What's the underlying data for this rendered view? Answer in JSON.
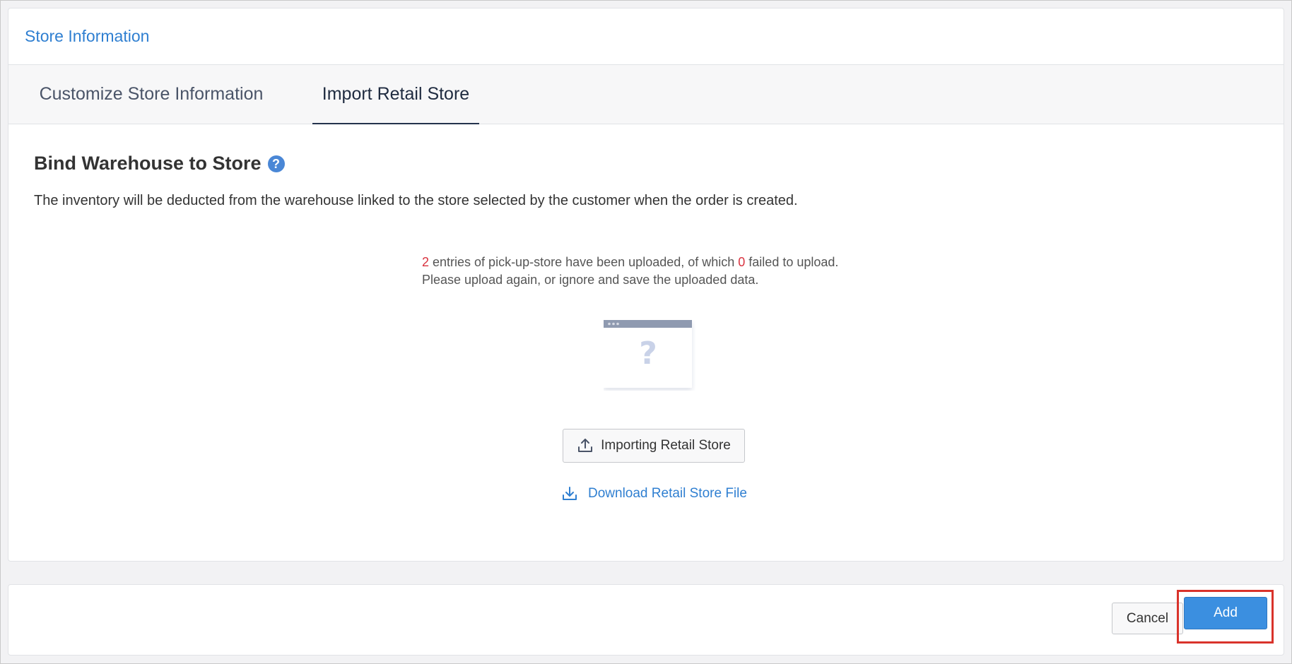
{
  "panel": {
    "title": "Store Information"
  },
  "tabs": [
    {
      "label": "Customize Store Information",
      "active": false
    },
    {
      "label": "Import Retail Store",
      "active": true
    }
  ],
  "section": {
    "title": "Bind Warehouse to Store",
    "help_icon": "question-circle-icon",
    "description": "The inventory will be deducted from the warehouse linked to the store selected by the customer when the order is created."
  },
  "upload_result": {
    "uploaded_count": "2",
    "text_part1": " entries of pick-up-store have been uploaded, of which ",
    "failed_count": "0",
    "text_part2": " failed to upload. Please upload again, or ignore and save the uploaded data."
  },
  "actions": {
    "import_label": "Importing Retail Store",
    "import_icon": "upload-icon",
    "download_label": "Download Retail Store File",
    "download_icon": "download-icon"
  },
  "footer": {
    "cancel_label": "Cancel",
    "add_label": "Add"
  },
  "colors": {
    "accent": "#2f7fd1",
    "primary_button": "#3b8fe0",
    "highlight_count": "#d9333f",
    "annotation_box": "#d9332b"
  }
}
